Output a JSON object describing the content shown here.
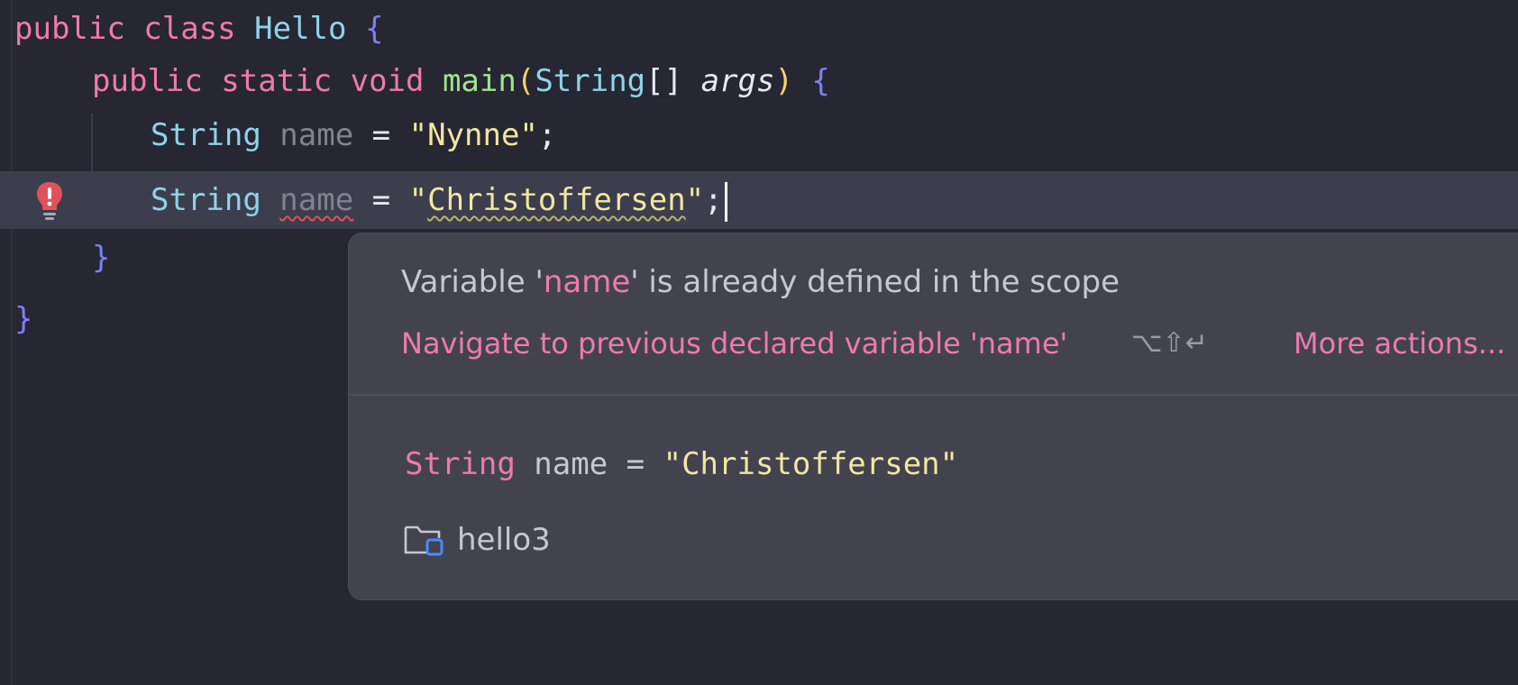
{
  "editor": {
    "lines": [
      {
        "tokens": [
          {
            "text": "public ",
            "cls": "kw"
          },
          {
            "text": "class ",
            "cls": "kw"
          },
          {
            "text": "Hello ",
            "cls": "cls"
          },
          {
            "text": "{",
            "cls": "brace"
          }
        ]
      },
      {
        "tokens": [
          {
            "text": "public ",
            "cls": "kw"
          },
          {
            "text": "static ",
            "cls": "kw"
          },
          {
            "text": "void ",
            "cls": "kw"
          },
          {
            "text": "main",
            "cls": "method"
          },
          {
            "text": "(",
            "cls": "paren"
          },
          {
            "text": "String",
            "cls": "type"
          },
          {
            "text": "[] ",
            "cls": "punct"
          },
          {
            "text": "args",
            "cls": "param"
          },
          {
            "text": ") ",
            "cls": "paren"
          },
          {
            "text": "{",
            "cls": "brace"
          }
        ]
      },
      {
        "tokens": [
          {
            "text": "String ",
            "cls": "type"
          },
          {
            "text": "name",
            "cls": "unused"
          },
          {
            "text": " = ",
            "cls": "punct"
          },
          {
            "text": "\"Nynne\"",
            "cls": "str"
          },
          {
            "text": ";",
            "cls": "punct"
          }
        ]
      },
      {
        "tokens": [
          {
            "text": "String ",
            "cls": "type"
          },
          {
            "text": "name",
            "cls": "unused err-underline"
          },
          {
            "text": " = ",
            "cls": "punct"
          },
          {
            "text": "\"",
            "cls": "str"
          },
          {
            "text": "Christoffersen",
            "cls": "str warn-underline"
          },
          {
            "text": "\"",
            "cls": "str"
          },
          {
            "text": ";",
            "cls": "punct"
          }
        ]
      },
      {
        "tokens": [
          {
            "text": "}",
            "cls": "brace"
          }
        ]
      },
      {
        "tokens": [
          {
            "text": "}",
            "cls": "brace"
          }
        ]
      }
    ]
  },
  "popup": {
    "message_prefix": "Variable '",
    "message_var": "name",
    "message_suffix": "' is already defined in the scope",
    "action_label": "Navigate to previous declared variable 'name'",
    "action_shortcut": "⌥⇧↵",
    "more_actions_label": "More actions...",
    "declaration_type": "String",
    "declaration_rest": " name = ",
    "declaration_value": "\"Christoffersen\"",
    "module_name": "hello3",
    "module_icon": "module-folder-icon"
  },
  "gutter": {
    "error_icon": "error-bulb-icon",
    "error_color": "#e0525a"
  }
}
